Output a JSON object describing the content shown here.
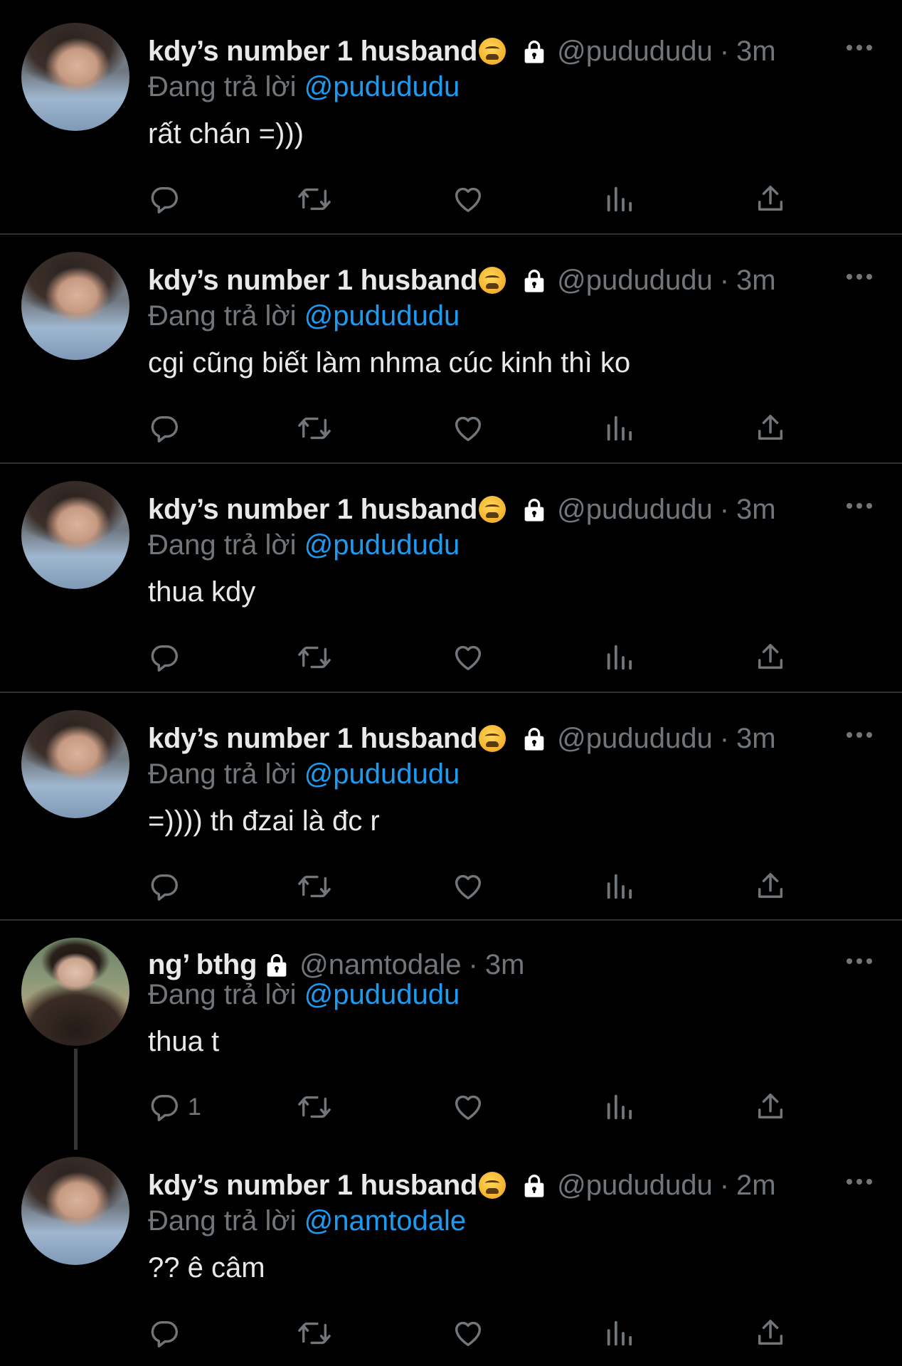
{
  "colors": {
    "background": "#000000",
    "text": "#e7e9ea",
    "muted": "#71767b",
    "link": "#1d9bf0",
    "divider": "#2f3336"
  },
  "tweets": [
    {
      "display_name": "kdy’s number 1 husband",
      "emoji": "tired-face-emoji",
      "protected": true,
      "handle": "@pudududu",
      "separator": "·",
      "time": "3m",
      "replying_label": "Đang trả lời",
      "replying_to": "@pudududu",
      "text": "rất chán =)))",
      "reply_count": ""
    },
    {
      "display_name": "kdy’s number 1 husband",
      "emoji": "tired-face-emoji",
      "protected": true,
      "handle": "@pudududu",
      "separator": "·",
      "time": "3m",
      "replying_label": "Đang trả lời",
      "replying_to": "@pudududu",
      "text": "cgi cũng biết làm nhma cúc kinh thì ko",
      "reply_count": ""
    },
    {
      "display_name": "kdy’s number 1 husband",
      "emoji": "tired-face-emoji",
      "protected": true,
      "handle": "@pudududu",
      "separator": "·",
      "time": "3m",
      "replying_label": "Đang trả lời",
      "replying_to": "@pudududu",
      "text": "thua kdy",
      "reply_count": ""
    },
    {
      "display_name": "kdy’s number 1 husband",
      "emoji": "tired-face-emoji",
      "protected": true,
      "handle": "@pudududu",
      "separator": "·",
      "time": "3m",
      "replying_label": "Đang trả lời",
      "replying_to": "@pudududu",
      "text": "=)))) th đzai là đc r",
      "reply_count": ""
    },
    {
      "display_name": "ng’ bthg",
      "protected": true,
      "handle": "@namtodale",
      "separator": "·",
      "time": "3m",
      "replying_label": "Đang trả lời",
      "replying_to": "@pudududu",
      "text": "thua t",
      "reply_count": "1"
    },
    {
      "display_name": "kdy’s number 1 husband",
      "emoji": "tired-face-emoji",
      "protected": true,
      "handle": "@pudududu",
      "separator": "·",
      "time": "2m",
      "replying_label": "Đang trả lời",
      "replying_to": "@namtodale",
      "text": "?? ê câm",
      "reply_count": ""
    }
  ],
  "icons": {
    "more": "more-dots-icon",
    "lock": "lock-icon",
    "reply": "reply-bubble-icon",
    "retweet": "retweet-icon",
    "like": "heart-icon",
    "views": "views-chart-icon",
    "share": "share-upload-icon"
  }
}
